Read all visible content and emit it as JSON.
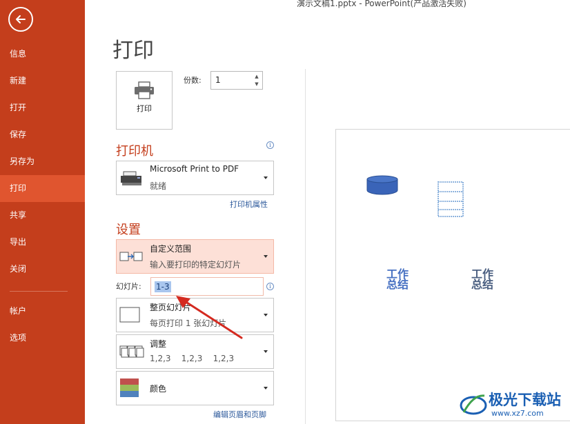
{
  "window": {
    "title": "演示文稿1.pptx - PowerPoint(产品激活失败)"
  },
  "sidebar": {
    "items": [
      {
        "label": "信息"
      },
      {
        "label": "新建"
      },
      {
        "label": "打开"
      },
      {
        "label": "保存"
      },
      {
        "label": "另存为"
      },
      {
        "label": "打印"
      },
      {
        "label": "共享"
      },
      {
        "label": "导出"
      },
      {
        "label": "关闭"
      },
      {
        "label": "帐户"
      },
      {
        "label": "选项"
      }
    ],
    "active": "打印"
  },
  "header": {
    "title": "打印"
  },
  "print": {
    "button_label": "打印",
    "copies_label": "份数:",
    "copies_value": "1"
  },
  "printer": {
    "section_title": "打印机",
    "name": "Microsoft Print to PDF",
    "status": "就绪",
    "properties_link": "打印机属性"
  },
  "settings": {
    "section_title": "设置",
    "range": {
      "title": "自定义范围",
      "subtitle": "输入要打印的特定幻灯片"
    },
    "slides_label": "幻灯片:",
    "slides_value": "1-3",
    "layout": {
      "title": "整页幻灯片",
      "subtitle": "每页打印 1 张幻灯片"
    },
    "collate": {
      "title": "调整",
      "subtitle": "1,2,3    1,2,3    1,2,3"
    },
    "color": {
      "title": "颜色"
    },
    "header_footer_link": "编辑页眉和页脚"
  },
  "preview": {
    "wordart_left": [
      "工作",
      "总结"
    ],
    "wordart_right": [
      "工作",
      "总结"
    ]
  },
  "watermark": {
    "text": "极光下载站",
    "url": "www.xz7.com"
  },
  "colors": {
    "accent": "#c43e1c",
    "active": "#e0552f",
    "link": "#2a579a"
  }
}
